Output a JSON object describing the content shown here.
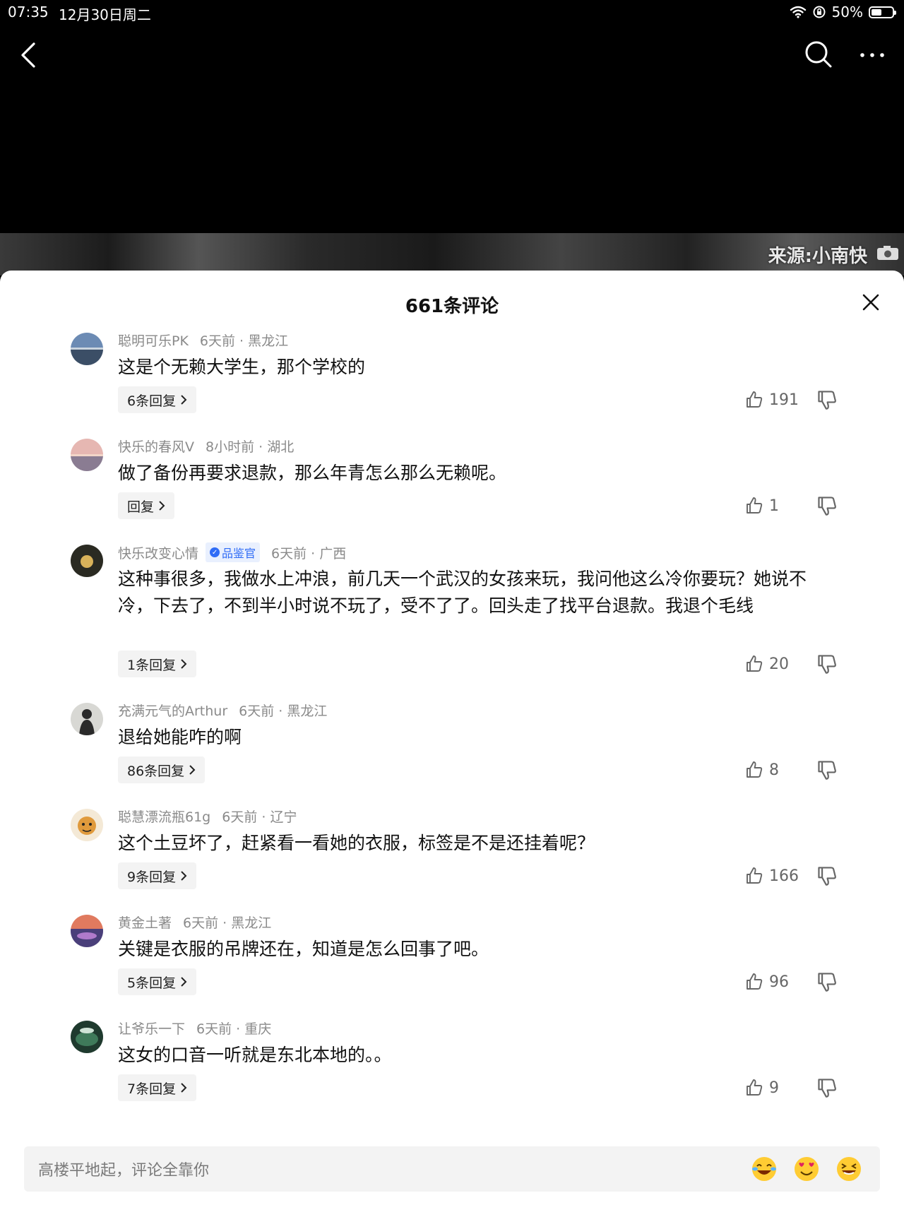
{
  "status_bar": {
    "time": "07:35",
    "date": "12月30日周二",
    "battery": "50%"
  },
  "video": {
    "watermark": "来源:小南快"
  },
  "comments_header": {
    "title": "661条评论"
  },
  "comments": [
    {
      "username": "聪明可乐PK",
      "badge": "",
      "time_location": "6天前 · 黑龙江",
      "text": "这是个无赖大学生，那个学校的",
      "reply_label": "6条回复",
      "likes": "191"
    },
    {
      "username": "快乐的春风V",
      "badge": "",
      "time_location": "8小时前 · 湖北",
      "text": "做了备份再要求退款，那么年青怎么那么无赖呢。",
      "reply_label": "回复",
      "likes": "1"
    },
    {
      "username": "快乐改变心情",
      "badge": "品鉴官",
      "time_location": "6天前 · 广西",
      "text": "这种事很多，我做水上冲浪，前几天一个武汉的女孩来玩，我问他这么冷你要玩？她说不冷，下去了，不到半小时说不玩了，受不了了。回头走了找平台退款。我退个毛线",
      "reply_label": "1条回复",
      "likes": "20"
    },
    {
      "username": "充满元气的Arthur",
      "badge": "",
      "time_location": "6天前 · 黑龙江",
      "text": "退给她能咋的啊",
      "reply_label": "86条回复",
      "likes": "8"
    },
    {
      "username": "聪慧漂流瓶61g",
      "badge": "",
      "time_location": "6天前 · 辽宁",
      "text": "这个土豆坏了，赶紧看一看她的衣服，标签是不是还挂着呢？",
      "reply_label": "9条回复",
      "likes": "166"
    },
    {
      "username": "黄金土著",
      "badge": "",
      "time_location": "6天前 · 黑龙江",
      "text": "关键是衣服的吊牌还在，知道是怎么回事了吧。",
      "reply_label": "5条回复",
      "likes": "96"
    },
    {
      "username": "让爷乐一下",
      "badge": "",
      "time_location": "6天前 · 重庆",
      "text": "这女的口音一听就是东北本地的。。",
      "reply_label": "7条回复",
      "likes": "9"
    }
  ],
  "input_bar": {
    "placeholder": "高楼平地起，评论全靠你"
  },
  "icons": {
    "back": "chevron-left-icon",
    "search": "search-icon",
    "more": "more-dots-icon",
    "close": "close-icon",
    "like": "thumbs-up-icon",
    "dislike": "thumbs-down-icon",
    "reply_arrow": "chevron-right-icon",
    "emoji1": "laughing-tears-emoji",
    "emoji2": "heart-eyes-emoji",
    "emoji3": "grinning-squint-emoji"
  },
  "colors": {
    "accent_blue": "#2f6cf6",
    "meta_gray": "#8a8a8a",
    "background": "#ffffff"
  }
}
